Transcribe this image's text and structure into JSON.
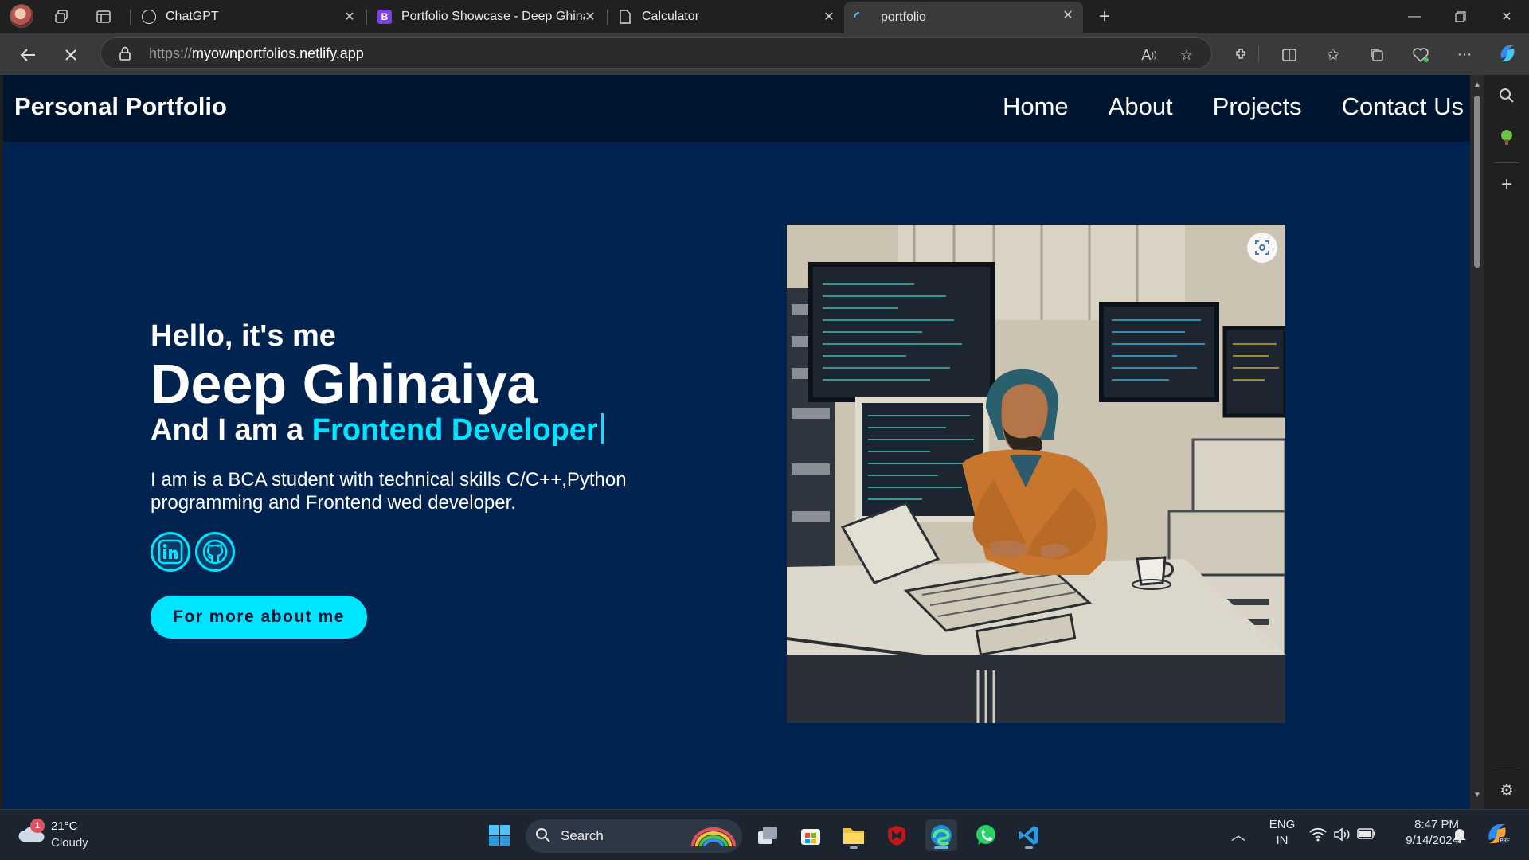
{
  "browser": {
    "tabs": [
      {
        "title": "ChatGPT",
        "favicon": "chatgpt-icon"
      },
      {
        "title": "Portfolio Showcase - Deep Ghinaiya",
        "favicon": "b-icon"
      },
      {
        "title": "Calculator",
        "favicon": "document-icon"
      },
      {
        "title": "portfolio",
        "favicon": "loading-icon",
        "active": true
      }
    ],
    "url_prefix": "https://",
    "url_host": "myownportfolios.netlify.app"
  },
  "site": {
    "brand": "Personal Portfolio",
    "nav": [
      "Home",
      "About",
      "Projects",
      "Contact Us"
    ],
    "hero": {
      "greeting": "Hello, it's me",
      "name": "Deep Ghinaiya",
      "role_prefix": "And I am a ",
      "role_highlight": "Frontend Developer",
      "description": "I am is a BCA student with technical skills C/C++,Python programming and Frontend wed developer.",
      "cta": "For more about me",
      "socials": [
        "linkedin-icon",
        "github-icon"
      ]
    },
    "accent_color": "#00e5ff",
    "background_color": "#002350"
  },
  "taskbar": {
    "weather_temp": "21°C",
    "weather_desc": "Cloudy",
    "weather_badge": "1",
    "search_placeholder": "Search",
    "lang_top": "ENG",
    "lang_bottom": "IN",
    "time": "8:47 PM",
    "date": "9/14/2024"
  }
}
